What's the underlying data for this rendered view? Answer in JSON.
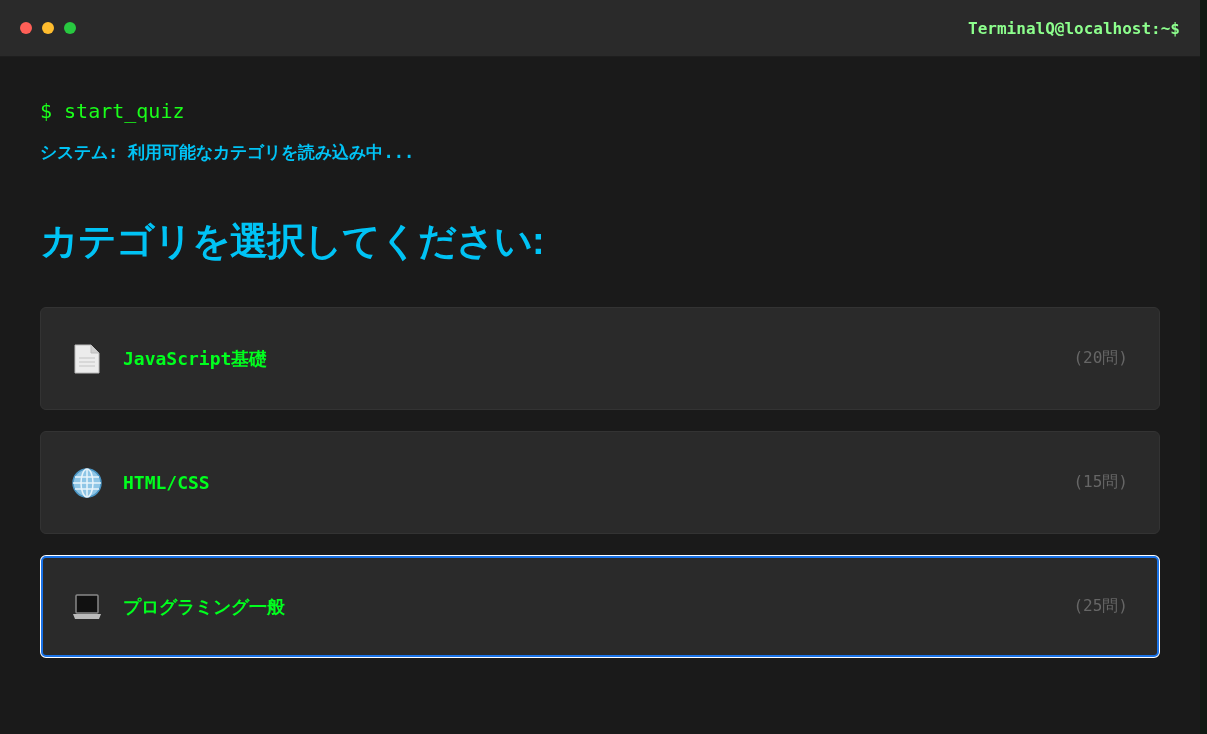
{
  "window": {
    "title": "TerminalQ@localhost:~$"
  },
  "terminal": {
    "command": "$ start_quiz",
    "system_message": "システム: 利用可能なカテゴリを読み込み中..."
  },
  "heading": "カテゴリを選択してください:",
  "categories": [
    {
      "name": "JavaScript基礎",
      "count": "(20問)",
      "focused": false
    },
    {
      "name": "HTML/CSS",
      "count": "(15問)",
      "focused": false
    },
    {
      "name": "プログラミング一般",
      "count": "(25問)",
      "focused": true
    }
  ]
}
